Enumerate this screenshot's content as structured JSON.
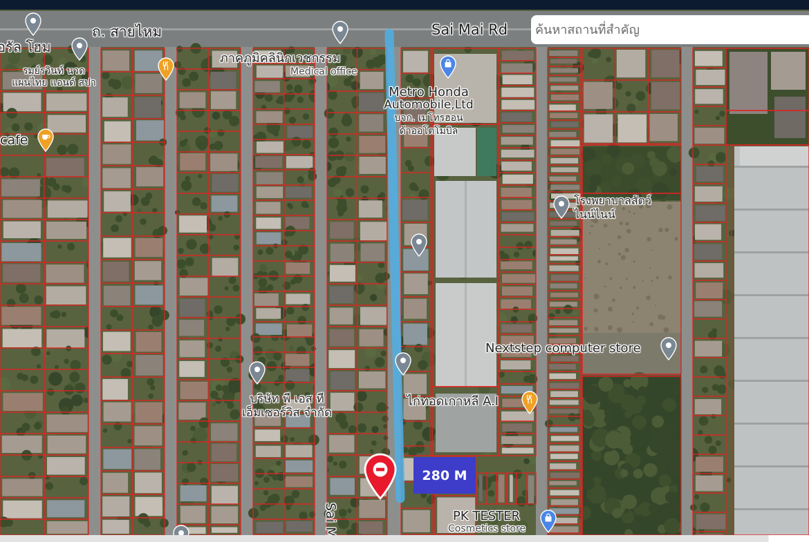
{
  "search": {
    "placeholder": "ค้นหาสถานที่สำคัญ"
  },
  "map": {
    "roads": {
      "main_th": "ถ. สายไหม",
      "main_en": "Sai Mai Rd",
      "soi": "Sai M"
    },
    "route": {
      "distance": "280 M"
    },
    "colors": {
      "parcel_outline": "#e32222",
      "route_line": "#4fb0e6",
      "distance_badge": "#3d3dc9",
      "marker": "#e8192c",
      "place_pin": "#7b8893",
      "food_pin": "#f0a024",
      "shop_pin": "#4a86e8"
    }
  },
  "places": {
    "home": {
      "name": "อรัล โฮม",
      "icon": "place-pin-icon"
    },
    "spa": {
      "line1": "รมย์รวินท์ นวด",
      "line2": "แผนไทย แอนด์ สปา"
    },
    "restaurant": {
      "icon": "restaurant-pin-icon"
    },
    "clinic": {
      "name": "ภาคภูมิคลินิกเวชกรรม",
      "category": "Medical office",
      "icon": "place-pin-icon"
    },
    "metro_honda": {
      "line1": "Metro Honda",
      "line2": "Automobile,Ltd",
      "line3": "บจก. เมโทรฮอน",
      "line4": "ด้าออโตโมบิล",
      "icon": "shopping-pin-icon"
    },
    "cafe": {
      "name": "cafe",
      "icon": "cafe-pin-icon"
    },
    "vet": {
      "line1": "โรงพยาบาลสัตว์",
      "line2": "ไนน์ไนน์",
      "icon": "place-pin-icon"
    },
    "nextstep": {
      "name": "Nextstep computer store",
      "icon": "place-pin-icon"
    },
    "pst": {
      "line1": "บริษัท พี เอส ที",
      "line2": "เอ็มเซอร์วิส จำกัด",
      "icon": "place-pin-icon"
    },
    "chicken": {
      "name": "ไก่ทอดเกาหลี A.I",
      "icon": "restaurant-pin-icon"
    },
    "pk_tester": {
      "name": "PK TESTER",
      "category": "Cosmetics store",
      "icon": "shopping-pin-icon"
    }
  }
}
